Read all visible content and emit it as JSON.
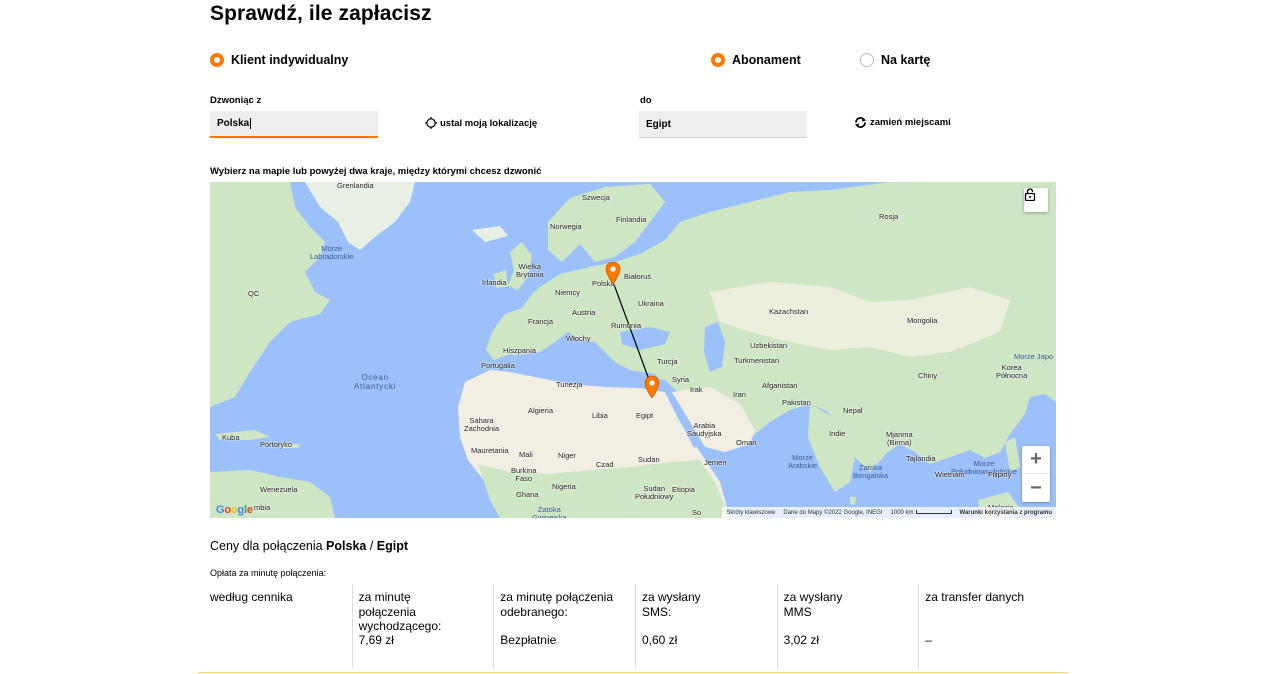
{
  "title": "Sprawdź, ile zapłacisz",
  "client_type": {
    "label": "Klient indywidualny",
    "selected": true
  },
  "plan_options": [
    {
      "label": "Abonament",
      "selected": true
    },
    {
      "label": "Na kartę",
      "selected": false
    }
  ],
  "from": {
    "label": "Dzwoniąc z",
    "value": "Polska"
  },
  "locate_label": "ustal moją lokalizację",
  "to": {
    "label": "do",
    "value": "Egipt"
  },
  "swap_label": "zamień miejscami",
  "map_hint": "Wybierz na mapie lub powyżej dwa kraje, między którymi chcesz dzwonić",
  "map": {
    "labels": {
      "grenlandia": "Grenlandia",
      "szwecja": "Szwecja",
      "finlandia": "Finlandia",
      "norwegia": "Norwegia",
      "rosja": "Rosja",
      "wielka_brytania": "Wielka\nBrytania",
      "irlandia": "Irlandia",
      "niemcy": "Niemcy",
      "polska": "Polska",
      "bialorus": "Białoruś",
      "ukraina": "Ukraina",
      "francja": "Francja",
      "austria": "Austria",
      "rumunia": "Rumunia",
      "wlochy": "Włochy",
      "hiszpania": "Hiszpania",
      "portugalia": "Portugalia",
      "turcja": "Turcja",
      "kazachstan": "Kazachstan",
      "mongolia": "Mongolia",
      "uzbekistan": "Uzbekistan",
      "turkmenistan": "Turkmenistan",
      "korea_polnocna": "Korea\nPółnocna",
      "afganistan": "Afganistan",
      "syria": "Syria",
      "irak": "Irak",
      "iran": "Iran",
      "tunezja": "Tunezja",
      "algieria": "Algieria",
      "libia": "Libia",
      "egipt": "Egipt",
      "pakistan": "Pakistan",
      "chiny": "Chiny",
      "nepal": "Nepal",
      "arabia": "Arabia\nSaudyjska",
      "indie": "Indie",
      "oman": "Oman",
      "sahara": "Sahara\nZachodnia",
      "mauretania": "Mauretania",
      "mali": "Mali",
      "niger": "Niger",
      "czad": "Czad",
      "sudan": "Sudan",
      "jemen": "Jemen",
      "mjanma": "Mjanma\n(Birma)",
      "tajlandia": "Tajlandia",
      "wietnam": "Wietnam",
      "filipiny": "Filipiny",
      "burkina": "Burkina\nFaso",
      "nigeria": "Nigeria",
      "ghana": "Ghana",
      "sudan_pd": "Sudan\nPołudniowy",
      "etiopia": "Etiopia",
      "somalia": "So",
      "malezja": "Malezja",
      "kuba": "Kuba",
      "portoryko": "Portoryko",
      "wenezuela": "Wenezuela",
      "kolumbia": "mbia",
      "qc": "QC",
      "japonia": "Morze Japo",
      "morze_lab": "Morze\nLabradorskie",
      "ocean": "Ocean\nAtlantycki",
      "morze_pd": "Morze\nPołudniowochińskie",
      "zatoka_beng": "Zatoka\nBengalska",
      "morze_arab": "Morze\nArabskie",
      "zatoka_gw": "Zatoka\nGwinejska"
    },
    "footer": {
      "shortcuts": "Skróty klawiszowe",
      "data": "Dane do Mapy ©2022 Google, INEGI",
      "scale": "1000 km",
      "terms": "Warunki korzystania z programu"
    },
    "google_letters": [
      "G",
      "o",
      "o",
      "g",
      "l",
      "e"
    ]
  },
  "prices": {
    "title_prefix": "Ceny dla połączenia ",
    "from": "Polska",
    "sep": " / ",
    "to": "Egipt",
    "per_minute_label": "Opłata za minutę połączenia:",
    "columns": [
      {
        "header": "według cennika",
        "value": ""
      },
      {
        "header": "za minutę połączenia wychodzącego:",
        "value": "7,69 zł"
      },
      {
        "header": "za minutę połączenia odebranego:",
        "value": "Bezpłatnie"
      },
      {
        "header": "za wysłany SMS:",
        "value": "0,60 zł"
      },
      {
        "header": "za wysłany MMS",
        "value": "3,02 zł"
      },
      {
        "header": "za transfer danych",
        "value": "–"
      }
    ]
  },
  "colors": {
    "accent": "#ff7900",
    "water": "#9cc0f9",
    "land": "#cfe6c4",
    "desert": "#f2eee4"
  }
}
